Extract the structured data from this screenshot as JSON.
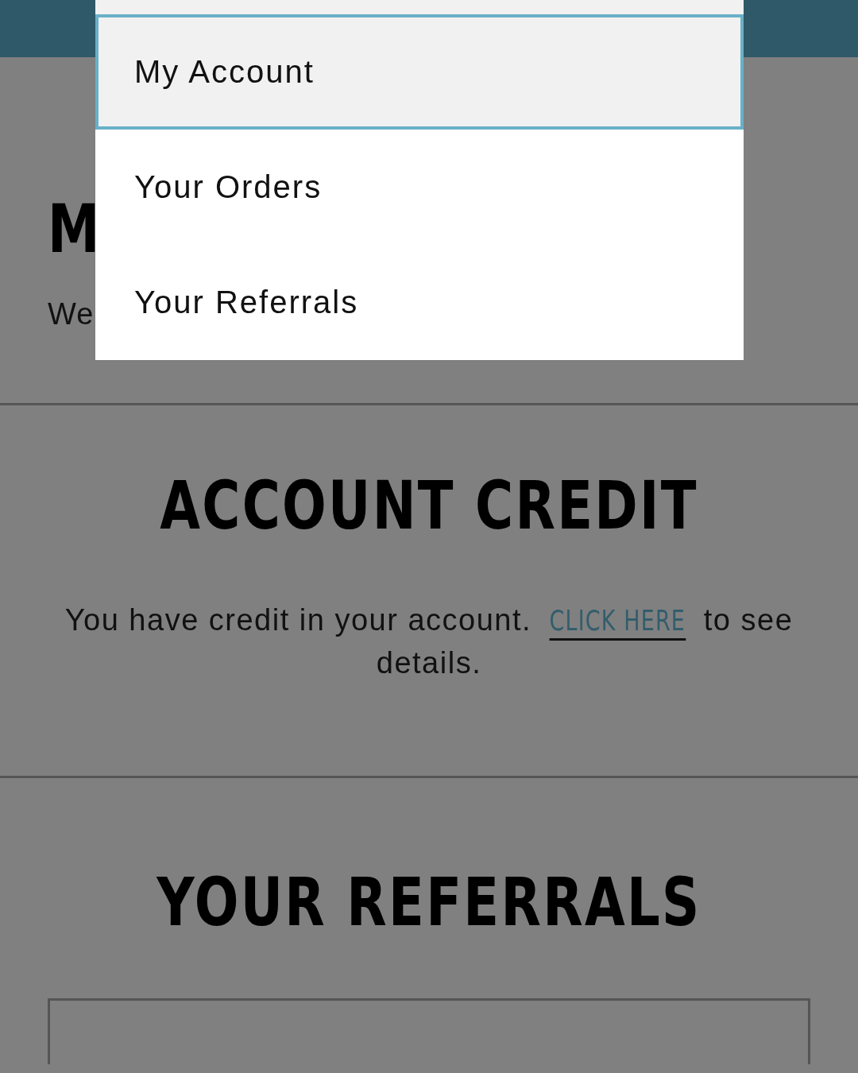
{
  "dropdown": {
    "items": [
      {
        "label": "My Account",
        "selected": true
      },
      {
        "label": "Your Orders",
        "selected": false
      },
      {
        "label": "Your Referrals",
        "selected": false
      }
    ]
  },
  "intro": {
    "heading": "M",
    "text": "We"
  },
  "credit": {
    "heading": "ACCOUNT CREDIT",
    "text_before": "You have credit in your account.",
    "link": "CLICK HERE",
    "text_after": "to see details."
  },
  "referrals": {
    "heading": "YOUR REFERRALS"
  }
}
